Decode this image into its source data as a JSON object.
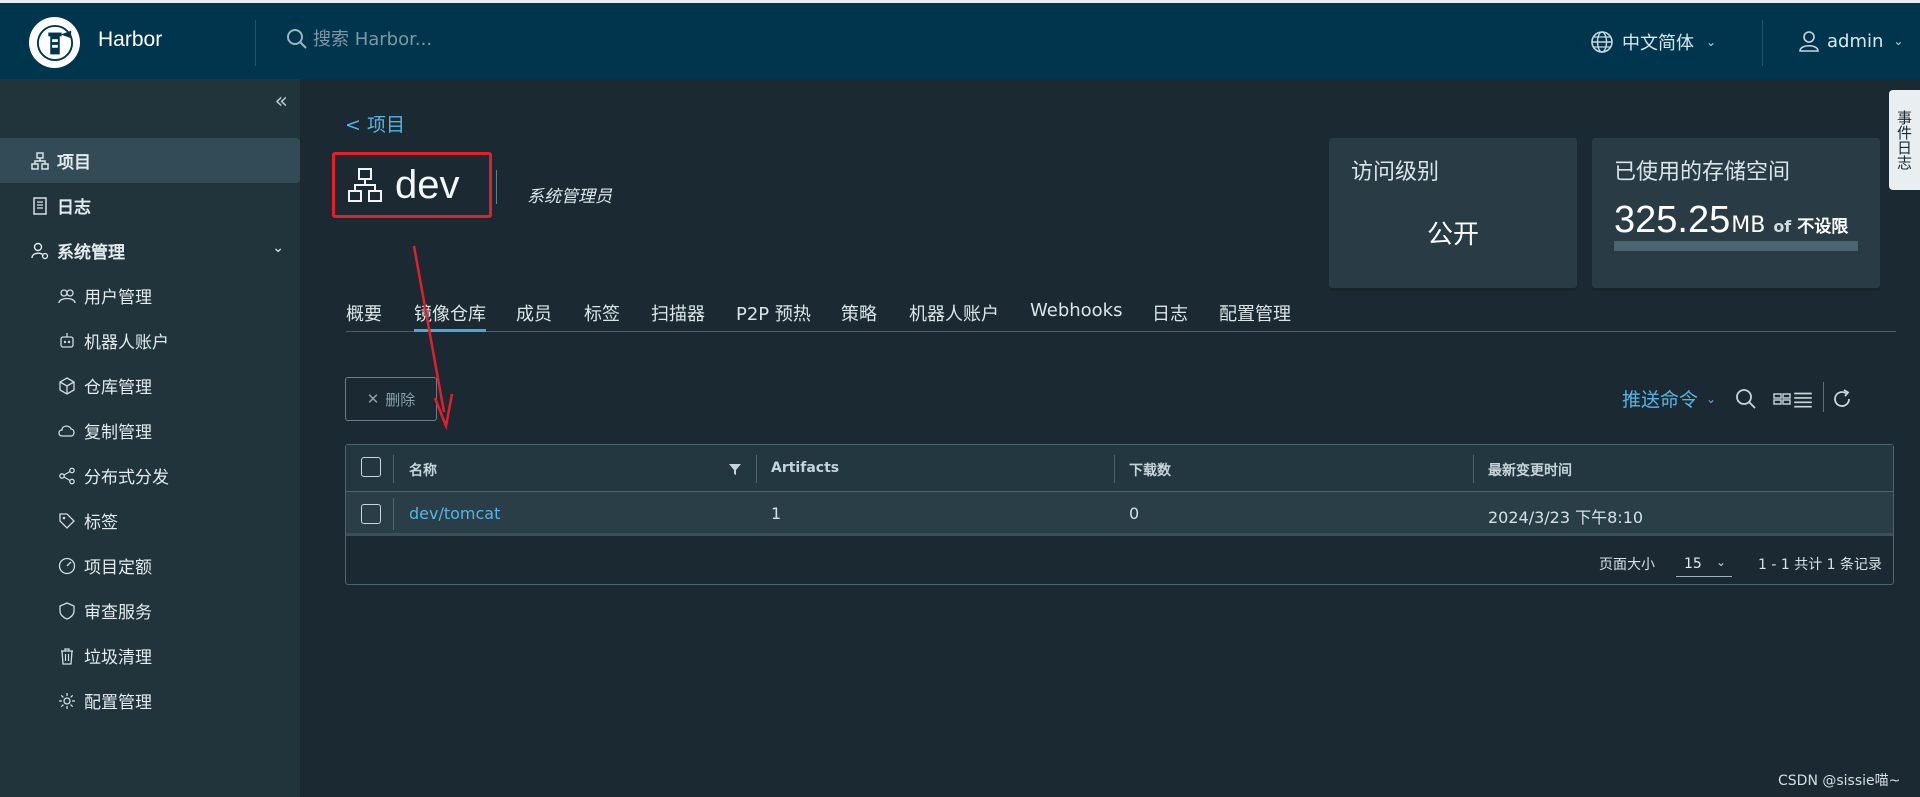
{
  "header": {
    "brand": "Harbor",
    "search_placeholder": "搜索 Harbor...",
    "language": "中文简体",
    "user": "admin"
  },
  "sidebar": {
    "items": [
      {
        "label": "项目",
        "icon": "projects-icon",
        "active": true
      },
      {
        "label": "日志",
        "icon": "log-icon"
      },
      {
        "label": "系统管理",
        "icon": "admin-icon",
        "expanded": true
      }
    ],
    "sub_items": [
      {
        "label": "用户管理",
        "icon": "users-icon"
      },
      {
        "label": "机器人账户",
        "icon": "robot-icon"
      },
      {
        "label": "仓库管理",
        "icon": "registry-icon"
      },
      {
        "label": "复制管理",
        "icon": "replication-icon"
      },
      {
        "label": "分布式分发",
        "icon": "share-icon"
      },
      {
        "label": "标签",
        "icon": "tag-icon"
      },
      {
        "label": "项目定额",
        "icon": "quota-icon"
      },
      {
        "label": "审查服务",
        "icon": "shield-icon"
      },
      {
        "label": "垃圾清理",
        "icon": "trash-icon"
      },
      {
        "label": "配置管理",
        "icon": "gear-icon"
      }
    ]
  },
  "project": {
    "back_label": "< 项目",
    "name": "dev",
    "role": "系统管理员"
  },
  "cards": {
    "access_title": "访问级别",
    "access_value": "公开",
    "storage_title": "已使用的存储空间",
    "storage_value": "325.25",
    "storage_unit": "MB",
    "storage_of": "of",
    "storage_limit": "不设限",
    "storage_fraction": 0.0
  },
  "tabs": [
    {
      "label": "概要"
    },
    {
      "label": "镜像仓库",
      "active": true
    },
    {
      "label": "成员"
    },
    {
      "label": "标签"
    },
    {
      "label": "扫描器"
    },
    {
      "label": "P2P 预热"
    },
    {
      "label": "策略"
    },
    {
      "label": "机器人账户"
    },
    {
      "label": "Webhooks"
    },
    {
      "label": "日志"
    },
    {
      "label": "配置管理"
    }
  ],
  "toolbar": {
    "delete_label": "删除",
    "push_command": "推送命令"
  },
  "table": {
    "columns": [
      "名称",
      "Artifacts",
      "下载数",
      "最新变更时间"
    ],
    "rows": [
      {
        "name": "dev/tomcat",
        "artifacts": "1",
        "downloads": "0",
        "updated": "2024/3/23 下午8:10"
      }
    ],
    "page_size_label": "页面大小",
    "page_size": "15",
    "summary": "1 - 1 共计 1 条记录"
  },
  "side_tab": "事件日志",
  "watermark": "CSDN @sissie喵~",
  "colors": {
    "header_bg": "#00364d",
    "sidebar_bg": "#21333b",
    "content_bg": "#1b2a32",
    "accent": "#57b4e4",
    "annotation": "#e0202a"
  }
}
